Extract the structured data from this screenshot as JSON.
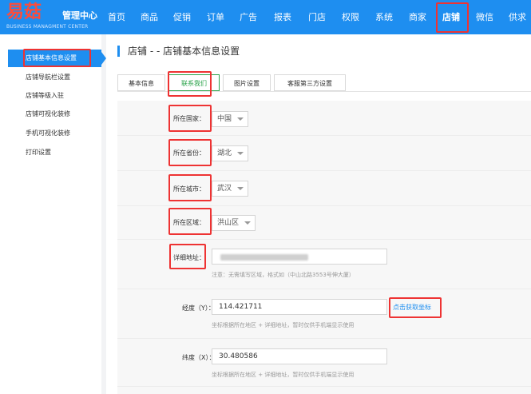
{
  "brand": {
    "logo_text": "易菇",
    "title": "管理中心",
    "subtitle": "BUSINESS MANAGMENT CENTER"
  },
  "nav": [
    "首页",
    "商品",
    "促销",
    "订单",
    "广告",
    "报表",
    "门店",
    "权限",
    "系统",
    "商家",
    "店铺",
    "微信",
    "供求"
  ],
  "nav_active": "店铺",
  "sidebar": [
    "店铺基本信息设置",
    "店铺导航栏设置",
    "店铺等级入驻",
    "店铺可视化装修",
    "手机可视化装修",
    "打印设置"
  ],
  "page_title": "店铺 - - 店铺基本信息设置",
  "tabs": [
    "基本信息",
    "联系我们",
    "图片设置",
    "客服第三方设置"
  ],
  "active_tab": "联系我们",
  "form": {
    "country_label": "所在国家：",
    "country_value": "中国",
    "province_label": "所在省份：",
    "province_value": "湖北",
    "city_label": "所在城市：",
    "city_value": "武汉",
    "district_label": "所在区域：",
    "district_value": "洪山区",
    "address_label": "详细地址：",
    "address_hint": "注意：无需填写区域，格式如（中山北路3553号伸大厦）",
    "lng_label": "经度（Y）：",
    "lng_value": "114.421711",
    "get_coord_link": "点击获取坐标",
    "lng_hint": "坐标根据所在地区 + 详细地址，暂时仅供手机端显示使用",
    "lat_label": "纬度（X）：",
    "lat_value": "30.480586",
    "lat_hint": "坐标根据所在地区 + 详细地址，暂时仅供手机端显示使用"
  },
  "colors": {
    "primary": "#1e8ef0",
    "highlight": "#e33333",
    "active_tab": "#2aa34a"
  }
}
